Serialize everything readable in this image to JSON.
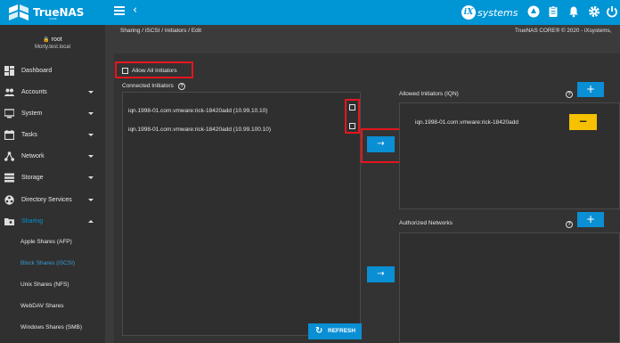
{
  "topbar": {
    "brand": "TrueNAS",
    "brand_sub": "CORE",
    "vendor_mark": "iX",
    "vendor_text": "systems",
    "icons": [
      "truecommand-icon",
      "clipboard-icon",
      "bell-icon",
      "gear-icon",
      "power-icon"
    ],
    "accent": "#0095d5"
  },
  "user": {
    "name": "root",
    "host": "Morty.test.local"
  },
  "nav": {
    "items": [
      {
        "label": "Dashboard",
        "icon": "dashboard-icon"
      },
      {
        "label": "Accounts",
        "icon": "accounts-icon"
      },
      {
        "label": "System",
        "icon": "monitor-icon"
      },
      {
        "label": "Tasks",
        "icon": "calendar-icon"
      },
      {
        "label": "Network",
        "icon": "network-icon"
      },
      {
        "label": "Storage",
        "icon": "storage-icon"
      },
      {
        "label": "Directory Services",
        "icon": "directory-icon"
      },
      {
        "label": "Sharing",
        "icon": "folder-share-icon"
      }
    ],
    "sub_items": [
      {
        "label": "Apple Shares (AFP)"
      },
      {
        "label": "Block Shares (iSCSI)"
      },
      {
        "label": "Unix Shares (NFS)"
      },
      {
        "label": "WebDAV Shares"
      },
      {
        "label": "Windows Shares (SMB)"
      }
    ]
  },
  "breadcrumb": {
    "text": "Sharing  /  iSCSI  /  Initiators  /  Edit",
    "copyright": "TrueNAS CORE® © 2020 - iXsystems,"
  },
  "form": {
    "allow_all_label": "Allow All Initiators",
    "connected_label": "Connected Initiators",
    "connected": [
      {
        "text": "iqn.1998-01.com.vmware:rick-18420add (10.99.10.10)"
      },
      {
        "text": "iqn.1998-01.com.vmware:rick-18420add (10.99.100.10)"
      }
    ],
    "allowed_label": "Allowed Initiators (IQN)",
    "allowed": [
      {
        "text": "iqn.1998-01.com.vmware:rick-18420add"
      }
    ],
    "networks_label": "Authorized Networks",
    "refresh_label": "REFRESH",
    "arrow": "→",
    "plus": "+",
    "minus": "−",
    "help": "?"
  }
}
